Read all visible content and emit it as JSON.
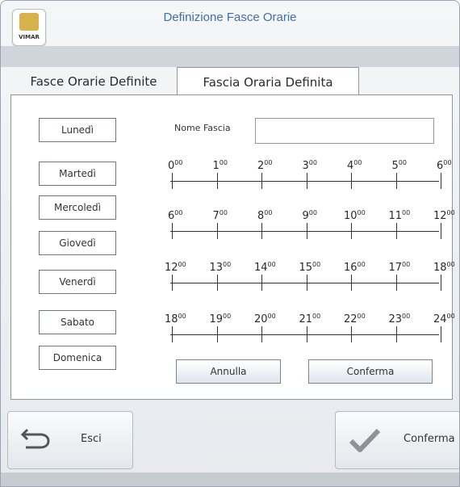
{
  "window": {
    "title": "Definizione Fasce Orarie",
    "logo_text": "VIMAR"
  },
  "tabs": [
    {
      "label": "Fasce Orarie Definite",
      "active": false
    },
    {
      "label": "Fascia Oraria Definita",
      "active": true
    }
  ],
  "days": [
    "Lunedì",
    "Martedì",
    "Mercoledì",
    "Giovedì",
    "Venerdì",
    "Sabato",
    "Domenica"
  ],
  "form": {
    "name_label": "Nome Fascia",
    "name_value": ""
  },
  "timeline_rows": [
    {
      "hours": [
        "0",
        "1",
        "2",
        "3",
        "4",
        "5",
        "6"
      ]
    },
    {
      "hours": [
        "6",
        "7",
        "8",
        "9",
        "10",
        "11",
        "12"
      ]
    },
    {
      "hours": [
        "12",
        "13",
        "14",
        "15",
        "16",
        "17",
        "18"
      ]
    },
    {
      "hours": [
        "18",
        "19",
        "20",
        "21",
        "22",
        "23",
        "24"
      ]
    }
  ],
  "minutes_suffix": "00",
  "panel_buttons": {
    "cancel": "Annulla",
    "confirm": "Conferma"
  },
  "footer": {
    "exit": "Esci",
    "confirm": "Conferma"
  },
  "colors": {
    "title": "#3f6fb0",
    "check": "#8e9399"
  }
}
